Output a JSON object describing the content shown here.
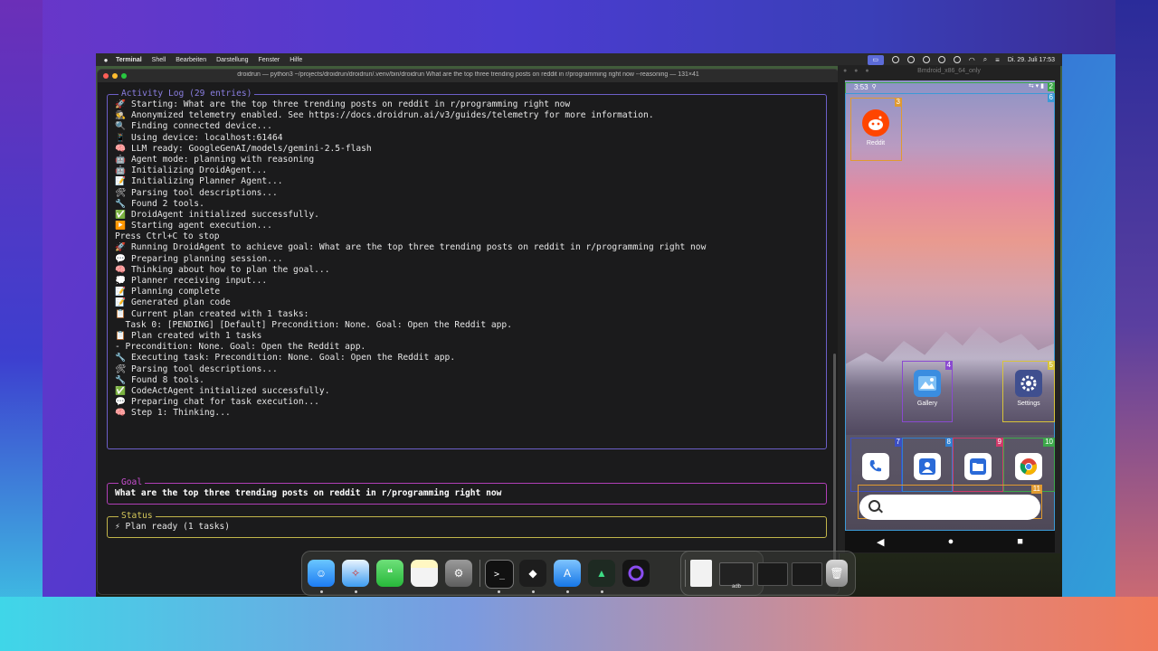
{
  "menubar": {
    "apple": "",
    "items": [
      "Terminal",
      "Shell",
      "Bearbeiten",
      "Darstellung",
      "Fenster",
      "Hilfe"
    ],
    "clock": "Di. 29. Juli 17:53"
  },
  "terminal": {
    "title": "droidrun — python3 ~/projects/droidrun/droidrun/.venv/bin/droidrun What are the top three trending posts on reddit in r/programming right now --reasoning — 131×41",
    "activity_log_label": "Activity Log (29 entries)",
    "lines": [
      {
        "icon": "🚀",
        "text": "Starting: What are the top three trending posts on reddit in r/programming right now"
      },
      {
        "icon": "🕵",
        "text": "Anonymized telemetry enabled. See https://docs.droidrun.ai/v3/guides/telemetry for more information."
      },
      {
        "icon": "🔍",
        "text": "Finding connected device..."
      },
      {
        "icon": "📱",
        "text": "Using device: localhost:61464"
      },
      {
        "icon": "🧠",
        "text": "LLM ready: GoogleGenAI/models/gemini-2.5-flash"
      },
      {
        "icon": "🤖",
        "text": "Agent mode: planning with reasoning"
      },
      {
        "icon": "🤖",
        "text": "Initializing DroidAgent..."
      },
      {
        "icon": "📝",
        "text": "Initializing Planner Agent..."
      },
      {
        "icon": "🛠",
        "text": "Parsing tool descriptions..."
      },
      {
        "icon": "🔧",
        "text": "Found 2 tools."
      },
      {
        "icon": "✅",
        "text": "DroidAgent initialized successfully."
      },
      {
        "icon": "▶️",
        "text": "Starting agent execution..."
      },
      {
        "icon": "",
        "text": "Press Ctrl+C to stop"
      },
      {
        "icon": "🚀",
        "text": "Running DroidAgent to achieve goal: What are the top three trending posts on reddit in r/programming right now"
      },
      {
        "icon": "💬",
        "text": "Preparing planning session..."
      },
      {
        "icon": "🧠",
        "text": "Thinking about how to plan the goal..."
      },
      {
        "icon": "💭",
        "text": "Planner receiving input..."
      },
      {
        "icon": "📝",
        "text": "Planning complete"
      },
      {
        "icon": "📝",
        "text": "Generated plan code"
      },
      {
        "icon": "📋",
        "text": "Current plan created with 1 tasks:"
      },
      {
        "icon": "",
        "text": "  Task 0: [PENDING] [Default] Precondition: None. Goal: Open the Reddit app."
      },
      {
        "icon": "📋",
        "text": "Plan created with 1 tasks"
      },
      {
        "icon": "",
        "text": "- Precondition: None. Goal: Open the Reddit app."
      },
      {
        "icon": "🔧",
        "text": "Executing task: Precondition: None. Goal: Open the Reddit app."
      },
      {
        "icon": "🛠",
        "text": "Parsing tool descriptions..."
      },
      {
        "icon": "🔧",
        "text": "Found 8 tools."
      },
      {
        "icon": "✅",
        "text": "CodeActAgent initialized successfully."
      },
      {
        "icon": "💬",
        "text": "Preparing chat for task execution..."
      },
      {
        "icon": "🧠",
        "text": "Step 1: Thinking..."
      }
    ],
    "goal_label": "Goal",
    "goal_text": "What are the top three trending posts on reddit in r/programming right now",
    "status_label": "Status",
    "status_text": "⚡ Plan ready (1 tasks)"
  },
  "emulator": {
    "title": "Bmdroid_x86_64_only",
    "status_time": "3:53",
    "apps": {
      "reddit": "Reddit",
      "gallery": "Gallery",
      "settings": "Settings"
    },
    "overlay_numbers": {
      "n2": "2",
      "n6": "6",
      "n3": "3",
      "n4": "4",
      "n5": "5",
      "n7": "7",
      "n8": "8",
      "n9": "9",
      "n10": "10",
      "n11": "11"
    },
    "nav": {
      "back": "◀",
      "home": "●",
      "recents": "■"
    }
  },
  "dock": {
    "adb_label": "adb"
  },
  "colors": {
    "activity_border": "#6c5fc8",
    "goal_border": "#b13fb7",
    "status_border": "#c2b54a"
  }
}
